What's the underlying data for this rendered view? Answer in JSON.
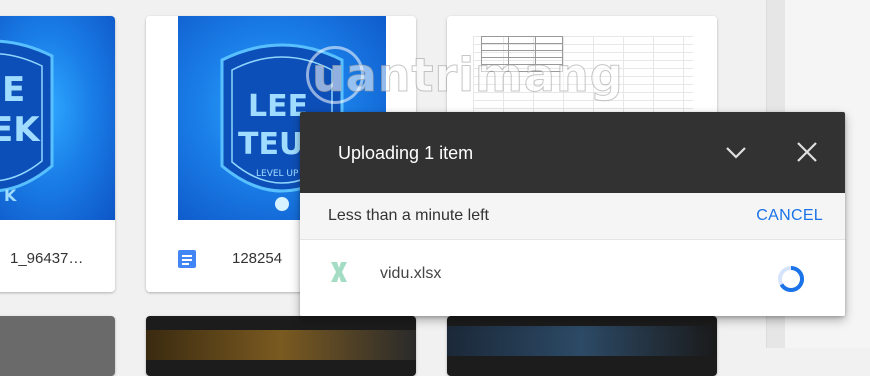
{
  "cards": [
    {
      "name": "1_96437…",
      "has_icon": false
    },
    {
      "name": "128254",
      "has_icon": true
    }
  ],
  "watermark": {
    "text": "uantrimang"
  },
  "upload_panel": {
    "title": "Uploading 1 item",
    "status": "Less than a minute left",
    "cancel_label": "CANCEL",
    "file": {
      "name": "vidu.xlsx",
      "icon": "excel-icon"
    }
  },
  "colors": {
    "panel_header": "#323232",
    "accent": "#1a73e8",
    "excel_icon": "#a5dcc4",
    "doc_icon": "#4285f4"
  }
}
